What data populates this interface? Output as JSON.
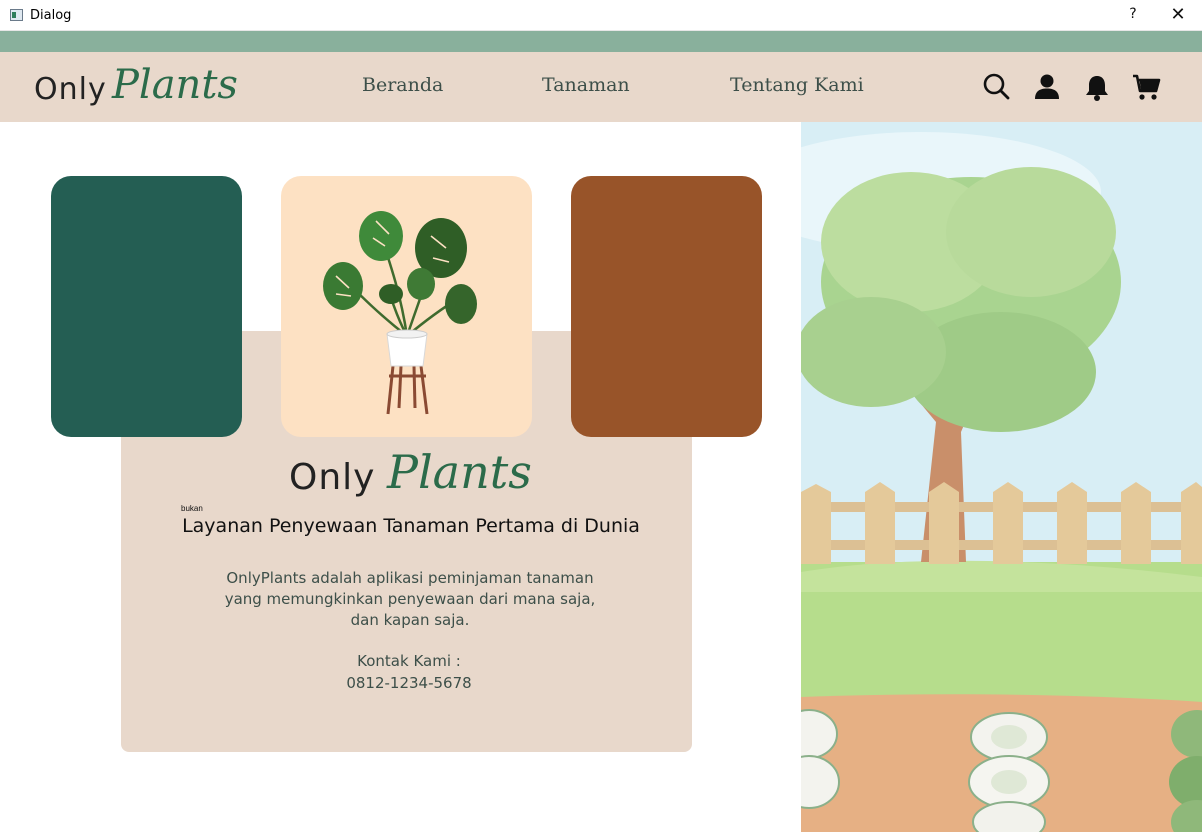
{
  "window": {
    "title": "Dialog",
    "help_label": "?",
    "close_label": "✕"
  },
  "brand": {
    "name_part1": "Only",
    "name_part2": "Plants"
  },
  "nav": {
    "links": [
      "Beranda",
      "Tanaman",
      "Tentang Kami"
    ],
    "icons": [
      "search-icon",
      "user-icon",
      "bell-icon",
      "cart-icon"
    ]
  },
  "hero": {
    "note": "bukan",
    "headline": "Layanan Penyewaan Tanaman Pertama di Dunia",
    "description": "OnlyPlants adalah aplikasi peminjaman tanaman yang memungkinkan penyewaan dari mana saja, dan kapan saja.",
    "contact_label": "Kontak Kami :",
    "contact_phone": "0812-1234-5678"
  },
  "colors": {
    "accent_strip": "#89b09c",
    "navbar": "#e8d8cb",
    "brand_green": "#2b6b4a",
    "card_green": "#245e53",
    "card_peach": "#fde1c3",
    "card_brown": "#985429"
  }
}
